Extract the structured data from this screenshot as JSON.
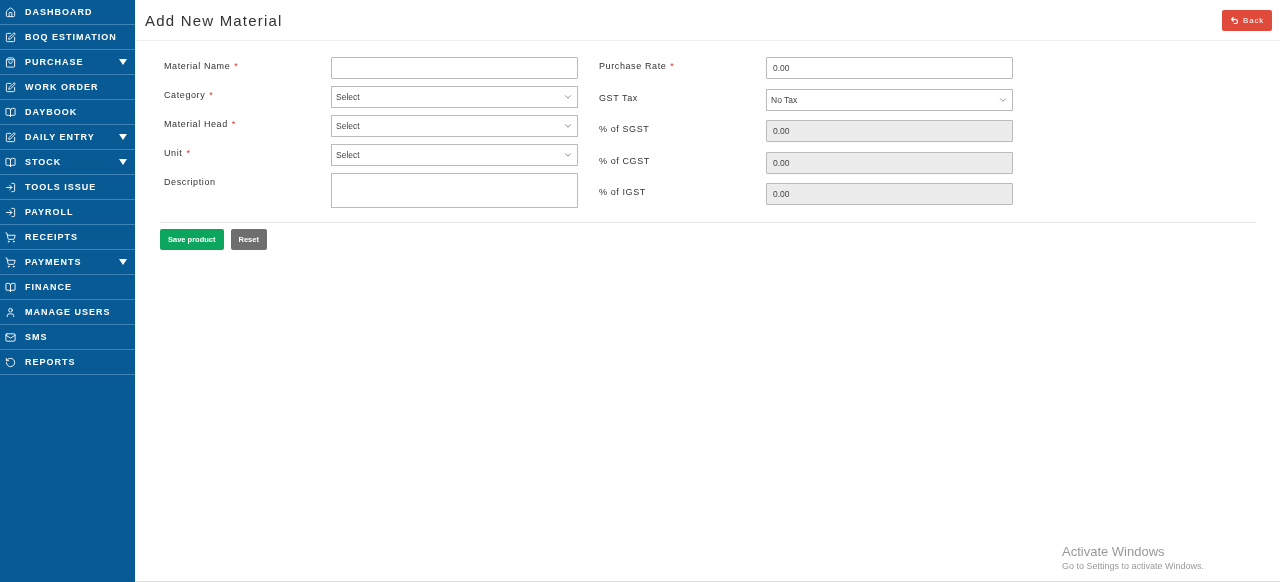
{
  "sidebar": {
    "items": [
      {
        "label": "DASHBOARD",
        "has_submenu": false
      },
      {
        "label": "BOQ ESTIMATION",
        "has_submenu": false
      },
      {
        "label": "PURCHASE",
        "has_submenu": true
      },
      {
        "label": "WORK ORDER",
        "has_submenu": false
      },
      {
        "label": "DAYBOOK",
        "has_submenu": false
      },
      {
        "label": "DAILY ENTRY",
        "has_submenu": true
      },
      {
        "label": "STOCK",
        "has_submenu": true
      },
      {
        "label": "TOOLS ISSUE",
        "has_submenu": false
      },
      {
        "label": "PAYROLL",
        "has_submenu": false
      },
      {
        "label": "RECEIPTS",
        "has_submenu": false
      },
      {
        "label": "PAYMENTS",
        "has_submenu": true
      },
      {
        "label": "FINANCE",
        "has_submenu": false
      },
      {
        "label": "MANAGE USERS",
        "has_submenu": false
      },
      {
        "label": "SMS",
        "has_submenu": false
      },
      {
        "label": "REPORTS",
        "has_submenu": false
      }
    ]
  },
  "header": {
    "title": "Add New Material",
    "back_button": "Back"
  },
  "form": {
    "left_fields": [
      {
        "label": "Material Name",
        "required_mark": "*",
        "kind": "text"
      },
      {
        "label": "Category",
        "required_mark": "*",
        "kind": "select",
        "value": "Select"
      },
      {
        "label": "Material Head",
        "required_mark": "*",
        "kind": "select",
        "value": "Select"
      },
      {
        "label": "Unit",
        "required_mark": "*",
        "kind": "select",
        "value": "Select"
      },
      {
        "label": "Description",
        "kind": "textarea"
      }
    ],
    "right_fields": [
      {
        "label": "Purchase Rate",
        "required_mark": "*",
        "kind": "text",
        "value": "0.00",
        "disabled": false
      },
      {
        "label": "GST Tax",
        "kind": "select",
        "value": "No Tax"
      },
      {
        "label": "% of SGST",
        "kind": "text",
        "value": "0.00",
        "disabled": true
      },
      {
        "label": "% of CGST",
        "kind": "text",
        "value": "0.00",
        "disabled": true
      },
      {
        "label": "% of IGST",
        "kind": "text",
        "value": "0.00",
        "disabled": true
      }
    ],
    "buttons": [
      {
        "label": "Save product",
        "kind": "primary"
      },
      {
        "label": "Reset",
        "kind": "secondary"
      }
    ]
  },
  "os_notice": {
    "title": "Activate Windows",
    "text": "Go to Settings to activate Windows."
  }
}
